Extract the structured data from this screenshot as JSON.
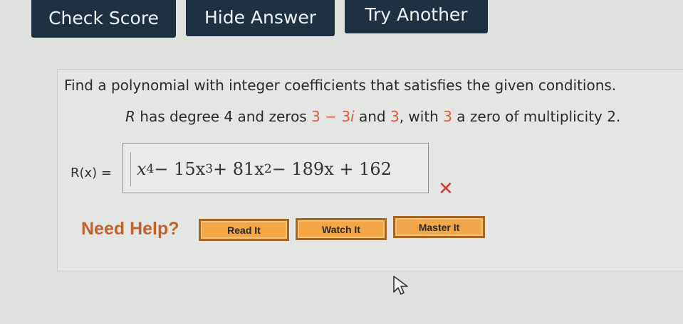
{
  "toolbar": {
    "check_score": "Check Score",
    "hide_answer": "Hide Answer",
    "try_another": "Try Another"
  },
  "question": {
    "prompt": "Find a polynomial with integer coefficients that satisfies the given conditions.",
    "condition": {
      "p1": "R",
      "p2": " has degree 4 and zeros ",
      "z1": "3",
      "p3": " − ",
      "z2": "3",
      "i": "i",
      "p4": " and ",
      "z3": "3",
      "p5": ", with ",
      "z4": "3",
      "p6": " a zero of multiplicity 2."
    }
  },
  "answer": {
    "label": "R(x) =",
    "terms": {
      "t1": "x",
      "e1": "4",
      "t2": " − 15x",
      "e2": "3",
      "t3": " + 81x",
      "e3": "2",
      "t4": " − 189x + 162"
    },
    "status_mark": "✕"
  },
  "help": {
    "label": "Need Help?",
    "read": "Read It",
    "watch": "Watch It",
    "master": "Master It"
  },
  "colors": {
    "toolbar_bg": "#1f3040",
    "highlight": "#e05a3a",
    "incorrect": "#d9363a",
    "help_label": "#c2622c",
    "help_button": "#f2a646"
  }
}
